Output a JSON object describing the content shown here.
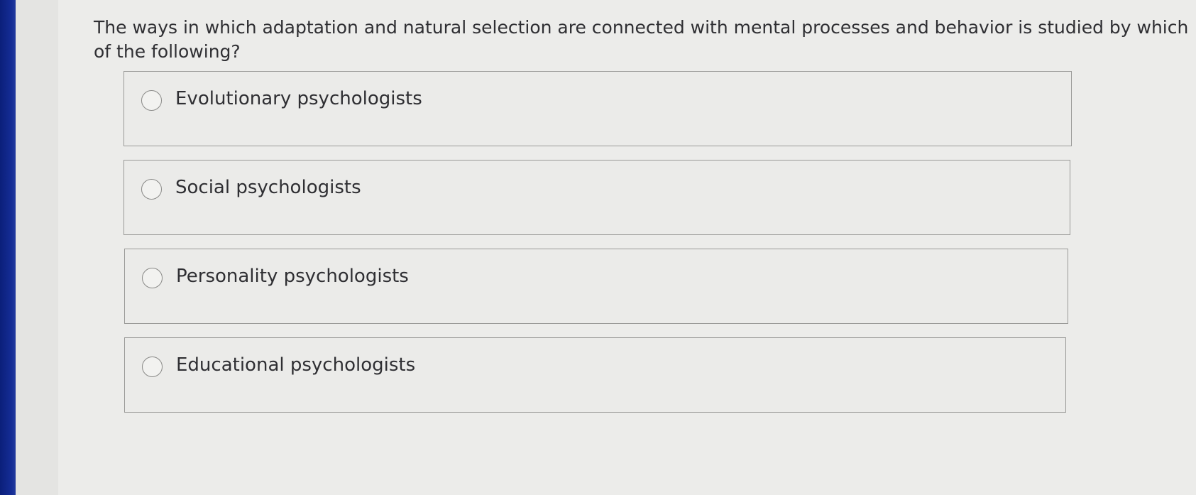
{
  "question": {
    "text": "The ways in which adaptation and natural selection are connected with mental processes and behavior is studied by which of the following?"
  },
  "options": [
    {
      "label": "Evolutionary psychologists",
      "selected": false
    },
    {
      "label": "Social psychologists",
      "selected": false
    },
    {
      "label": "Personality psychologists",
      "selected": false
    },
    {
      "label": "Educational psychologists",
      "selected": false
    }
  ],
  "colors": {
    "bezel": "#142c94",
    "page_background": "#ececea",
    "option_border": "#9a9a98",
    "text": "#2f2f33"
  }
}
